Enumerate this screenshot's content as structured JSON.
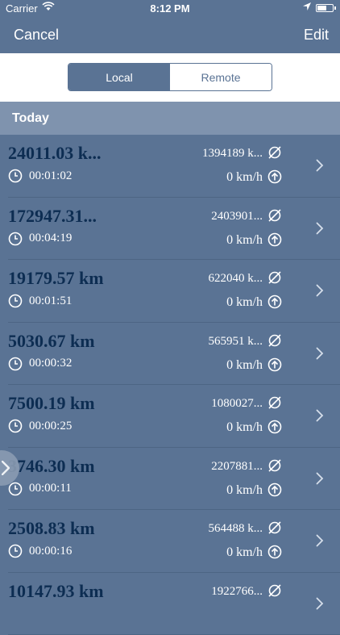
{
  "status_bar": {
    "carrier": "Carrier",
    "time": "8:12 PM"
  },
  "nav": {
    "cancel_label": "Cancel",
    "edit_label": "Edit"
  },
  "segments": [
    "Local",
    "Remote"
  ],
  "section": {
    "title": "Today"
  },
  "rows": [
    {
      "distance": "24011.03 k...",
      "duration": "00:01:02",
      "total": "1394189 k...",
      "speed": "0 km/h"
    },
    {
      "distance": "172947.31...",
      "duration": "00:04:19",
      "total": "2403901...",
      "speed": "0 km/h"
    },
    {
      "distance": "19179.57 km",
      "duration": "00:01:51",
      "total": "622040 k...",
      "speed": "0 km/h"
    },
    {
      "distance": "5030.67 km",
      "duration": "00:00:32",
      "total": "565951 k...",
      "speed": "0 km/h"
    },
    {
      "distance": "7500.19 km",
      "duration": "00:00:25",
      "total": "1080027...",
      "speed": "0 km/h"
    },
    {
      "distance": "3746.30 km",
      "duration": "00:00:11",
      "total": "2207881...",
      "speed": "0 km/h"
    },
    {
      "distance": "2508.83 km",
      "duration": "00:00:16",
      "total": "564488 k...",
      "speed": "0 km/h"
    },
    {
      "distance": "10147.93 km",
      "duration": "",
      "total": "1922766...",
      "speed": ""
    }
  ],
  "colors": {
    "bar": "#5a7394",
    "header": "#7f93ae",
    "distance": "#0d2d52"
  }
}
